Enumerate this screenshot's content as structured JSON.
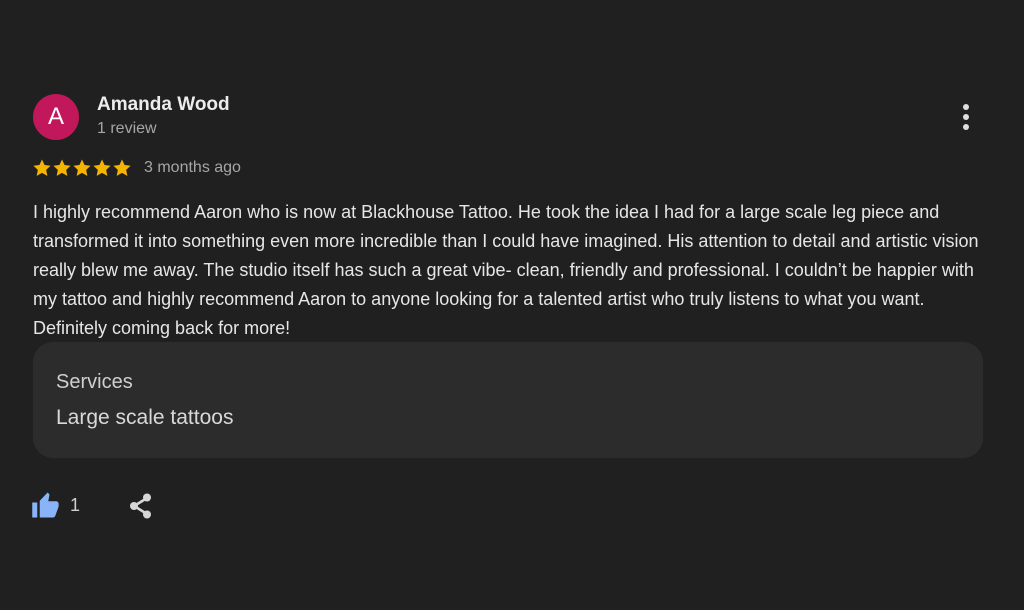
{
  "review": {
    "author": {
      "initial": "A",
      "name": "Amanda Wood",
      "meta": "1 review",
      "avatar_color": "#c2185b"
    },
    "rating": {
      "stars": 5,
      "max": 5,
      "star_color": "#f5b400"
    },
    "date": "3 months ago",
    "text": "I highly recommend Aaron who is now at Blackhouse Tattoo. He took the idea I had for a large scale leg piece and transformed it into something even more incredible than I could have imagined. His attention to detail and artistic vision really blew me away. The studio itself has such a great vibe- clean, friendly and professional. I couldn’t be happier with my tattoo and highly recommend Aaron to anyone looking for a talented artist who truly listens to what you want. Definitely coming back for more!",
    "services": {
      "title": "Services",
      "value": "Large scale tattoos"
    },
    "actions": {
      "like_count": "1",
      "like_icon": "thumbs-up-icon",
      "like_color": "#8ab4f8",
      "share_icon": "share-icon",
      "more_icon": "more-vertical-icon"
    }
  }
}
